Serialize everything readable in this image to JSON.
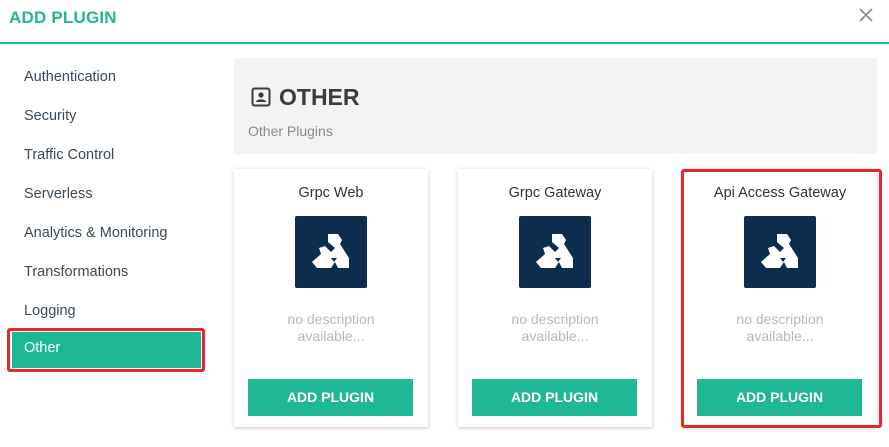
{
  "header": {
    "title": "ADD PLUGIN",
    "close_icon": "close-icon"
  },
  "sidebar": {
    "items": [
      {
        "label": "Authentication"
      },
      {
        "label": "Security"
      },
      {
        "label": "Traffic Control"
      },
      {
        "label": "Serverless"
      },
      {
        "label": "Analytics & Monitoring"
      },
      {
        "label": "Transformations"
      },
      {
        "label": "Logging"
      },
      {
        "label": "Other",
        "active": true
      }
    ]
  },
  "section": {
    "icon": "contact-card-icon",
    "title": "OTHER",
    "subtitle": "Other Plugins"
  },
  "cards": [
    {
      "name": "Grpc Web",
      "description": "no description available...",
      "button": "ADD PLUGIN",
      "logo": "kong-gorilla-icon"
    },
    {
      "name": "Grpc Gateway",
      "description": "no description available...",
      "button": "ADD PLUGIN",
      "logo": "kong-gorilla-icon"
    },
    {
      "name": "Api Access Gateway",
      "description": "no description available...",
      "button": "ADD PLUGIN",
      "logo": "kong-gorilla-icon",
      "highlighted": true
    }
  ],
  "colors": {
    "accent": "#1fb896",
    "highlight": "#e8272a",
    "logo_bg": "#0e2d4e"
  }
}
